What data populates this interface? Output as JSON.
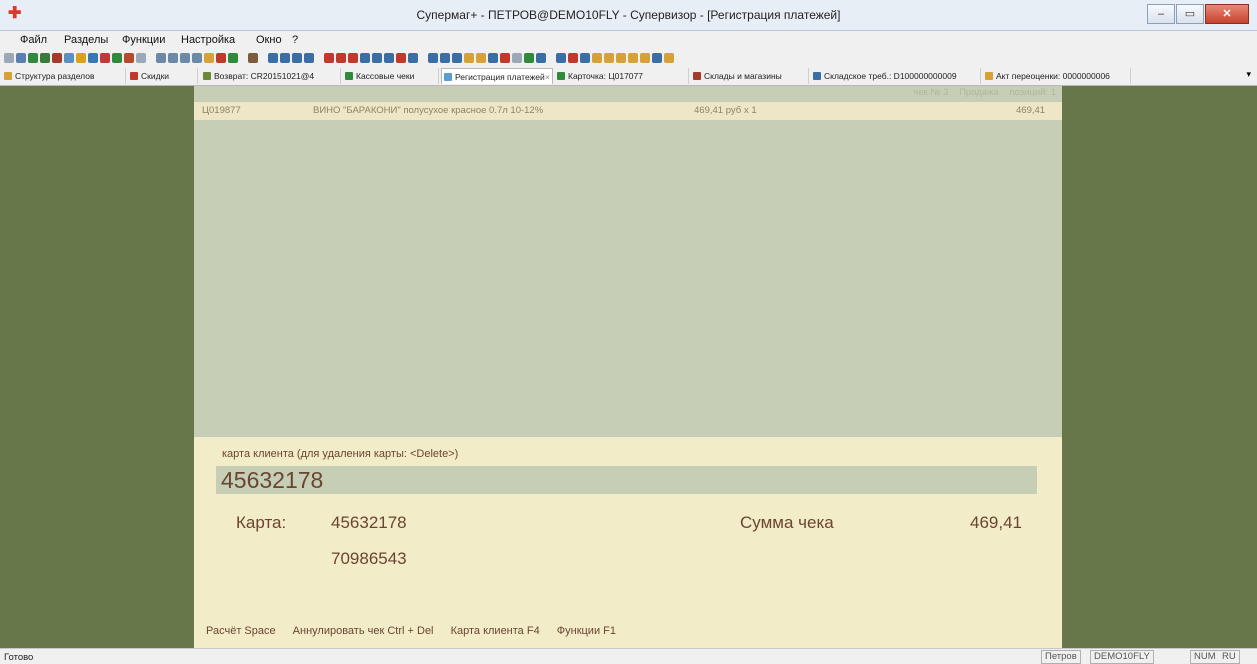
{
  "window": {
    "title": "Супермаг+ - ПЕТРОВ@DEMO10FLY - Супервизор  - [Регистрация платежей]",
    "minimize": "–",
    "restore": "▭",
    "close": "✕"
  },
  "menu": [
    "Файл",
    "Разделы",
    "Функции",
    "Настройка",
    "Окно",
    "?"
  ],
  "tabs": [
    {
      "label": "Структура разделов",
      "active": false
    },
    {
      "label": "Скидки",
      "active": false
    },
    {
      "label": "Возврат: CR20151021@4",
      "active": false
    },
    {
      "label": "Кассовые чеки",
      "active": false
    },
    {
      "label": "Регистрация платежей",
      "active": true
    },
    {
      "label": "Карточка: Ц017077",
      "active": false
    },
    {
      "label": "Склады и магазины",
      "active": false
    },
    {
      "label": "Складское треб.: D100000000009",
      "active": false
    },
    {
      "label": "Акт переоценки: 0000000006",
      "active": false
    }
  ],
  "tab_more": "▾",
  "receipt": {
    "header": {
      "check": "чек № 3",
      "mode": "Продажа",
      "positions": "позиций: 1"
    },
    "items": [
      {
        "code": "Ц019877",
        "name": "ВИНО \"БАРАКОНИ\" полусухое красное 0.7л 10-12%",
        "price": "469,41 руб",
        "qty": "x 1",
        "sum": "469,41"
      }
    ]
  },
  "client_card": {
    "caption": "карта клиента (для удаления карты: <Delete>)",
    "input_value": "45632178",
    "card_label": "Карта:",
    "cards": [
      "45632178",
      "70986543"
    ],
    "sum_label": "Сумма чека",
    "sum_value": "469,41"
  },
  "hotkeys": [
    "Расчёт Space",
    "Аннулировать чек Ctrl + Del",
    "Карта клиента F4",
    "Функции F1"
  ],
  "status": {
    "text": "Готово",
    "user": "Петров",
    "db": "DEMO10FLY",
    "numlock": "NUM",
    "lang": "RU"
  },
  "colors": {
    "side_panel": "#68774a",
    "receipt_bg": "#c6cfb6",
    "bottom_panel": "#f3ecc9",
    "text_brown": "#6a4532"
  }
}
